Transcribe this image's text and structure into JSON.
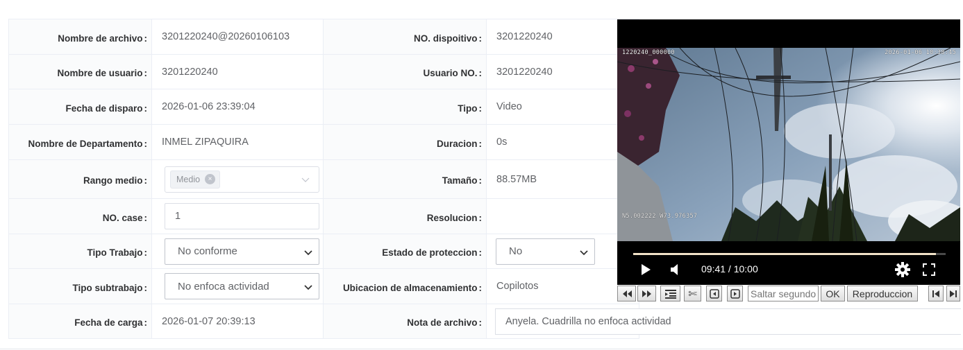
{
  "fields": {
    "file_name": {
      "label": "Nombre de archivo",
      "value": "3201220240@20260106103"
    },
    "device_no": {
      "label": "NO. dispoitivo",
      "value": "3201220240"
    },
    "user_name": {
      "label": "Nombre de usuario",
      "value": "3201220240"
    },
    "user_no": {
      "label": "Usuario NO.",
      "value": "3201220240"
    },
    "shot_date": {
      "label": "Fecha de disparo",
      "value": "2026-01-06 23:39:04"
    },
    "type": {
      "label": "Tipo",
      "value": "Video"
    },
    "department": {
      "label": "Nombre de Departamento",
      "value": "INMEL ZIPAQUIRA"
    },
    "duration": {
      "label": "Duracion",
      "value": "0s"
    },
    "media_range": {
      "label": "Rango medio",
      "tag": "Medio",
      "tag_close": "×"
    },
    "size": {
      "label": "Tamaño",
      "value": "88.57MB"
    },
    "case_no": {
      "label": "NO. case",
      "value": "1"
    },
    "resolution": {
      "label": "Resolucion",
      "value": ""
    },
    "work_type": {
      "label": "Tipo Trabajo",
      "value": "No conforme"
    },
    "protection": {
      "label": "Estado de proteccion",
      "value": "No"
    },
    "work_subtype": {
      "label": "Tipo subtrabajo",
      "value": "No enfoca actividad"
    },
    "storage": {
      "label": "Ubicacion de almacenamiento",
      "value": "Copilotos"
    },
    "upload_date": {
      "label": "Fecha de carga",
      "value": "2026-01-07 20:39:13"
    },
    "file_note": {
      "label": "Nota de archivo",
      "value": "Anyela. Cuadrilla no enfoca actividad"
    }
  },
  "colon": ":",
  "video": {
    "overlay_top_left": "1220240_000000",
    "overlay_top_right": "2026-01-06  10:38:45",
    "overlay_bottom_left": "N5.002222  W73.976357",
    "time": "09:41 / 10:00",
    "progress_fraction": 0.969,
    "icons": [
      "play-icon",
      "volume-icon",
      "settings-gear-icon",
      "fullscreen-icon"
    ]
  },
  "toolbar": {
    "seek_placeholder": "Saltar segundos",
    "ok_label": "OK",
    "playback_label": "Reproduccion",
    "cut_glyph": "✄",
    "icons": [
      "rewind-icon",
      "fast-forward-icon",
      "list-icon",
      "scissors-icon",
      "prev-frame-icon",
      "next-frame-icon",
      "skip-start-icon",
      "skip-end-icon"
    ]
  },
  "colors": {
    "border": "#ebeef5",
    "label_bg": "#fafbfc",
    "label_text": "#303133",
    "value_text": "#606266"
  }
}
